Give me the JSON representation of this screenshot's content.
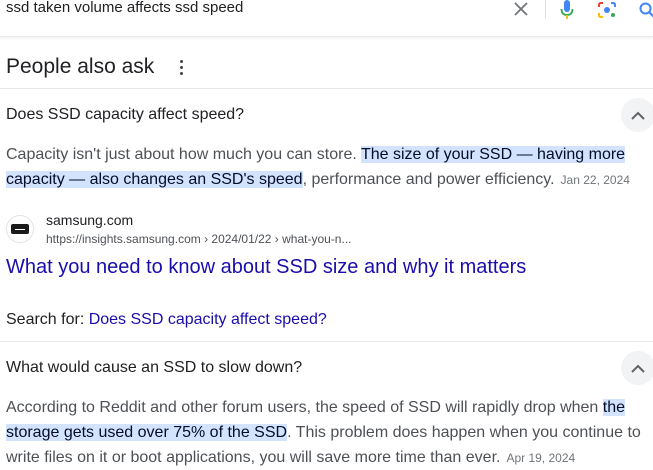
{
  "search": {
    "query": "ssd taken volume affects ssd speed"
  },
  "icons": {
    "clear": "close-icon",
    "mic": "microphone-icon",
    "lens": "google-lens-icon",
    "search": "search-icon"
  },
  "colors": {
    "link": "#1a0dab",
    "highlight": "#d3e3fd",
    "mic_blue": "#4285f4",
    "mic_red": "#ea4335",
    "lens_yellow": "#fbbc04",
    "lens_green": "#34a853"
  },
  "paa": {
    "title": "People also ask",
    "questions": [
      {
        "question": "Does SSD capacity affect speed?",
        "answer_pre": "Capacity isn't just about how much you can store. ",
        "answer_highlight": "The size of your SSD — having more capacity — also changes an SSD's speed",
        "answer_post": ", performance and power efficiency.",
        "date": "Jan 22, 2024",
        "source_name": "samsung.com",
        "source_url": "https://insights.samsung.com › 2024/01/22 › what-you-n...",
        "link_title": "What you need to know about SSD size and why it matters",
        "search_for_label": "Search for: ",
        "search_for_query": "Does SSD capacity affect speed?"
      },
      {
        "question": "What would cause an SSD to slow down?",
        "answer_pre": "According to Reddit and other forum users, the speed of SSD will rapidly drop when ",
        "answer_highlight": "the storage gets used over 75% of the SSD",
        "answer_post": ". This problem does happen when you continue to write files on it or boot applications, you will save more time than ever.",
        "date": "Apr 19, 2024"
      }
    ]
  }
}
